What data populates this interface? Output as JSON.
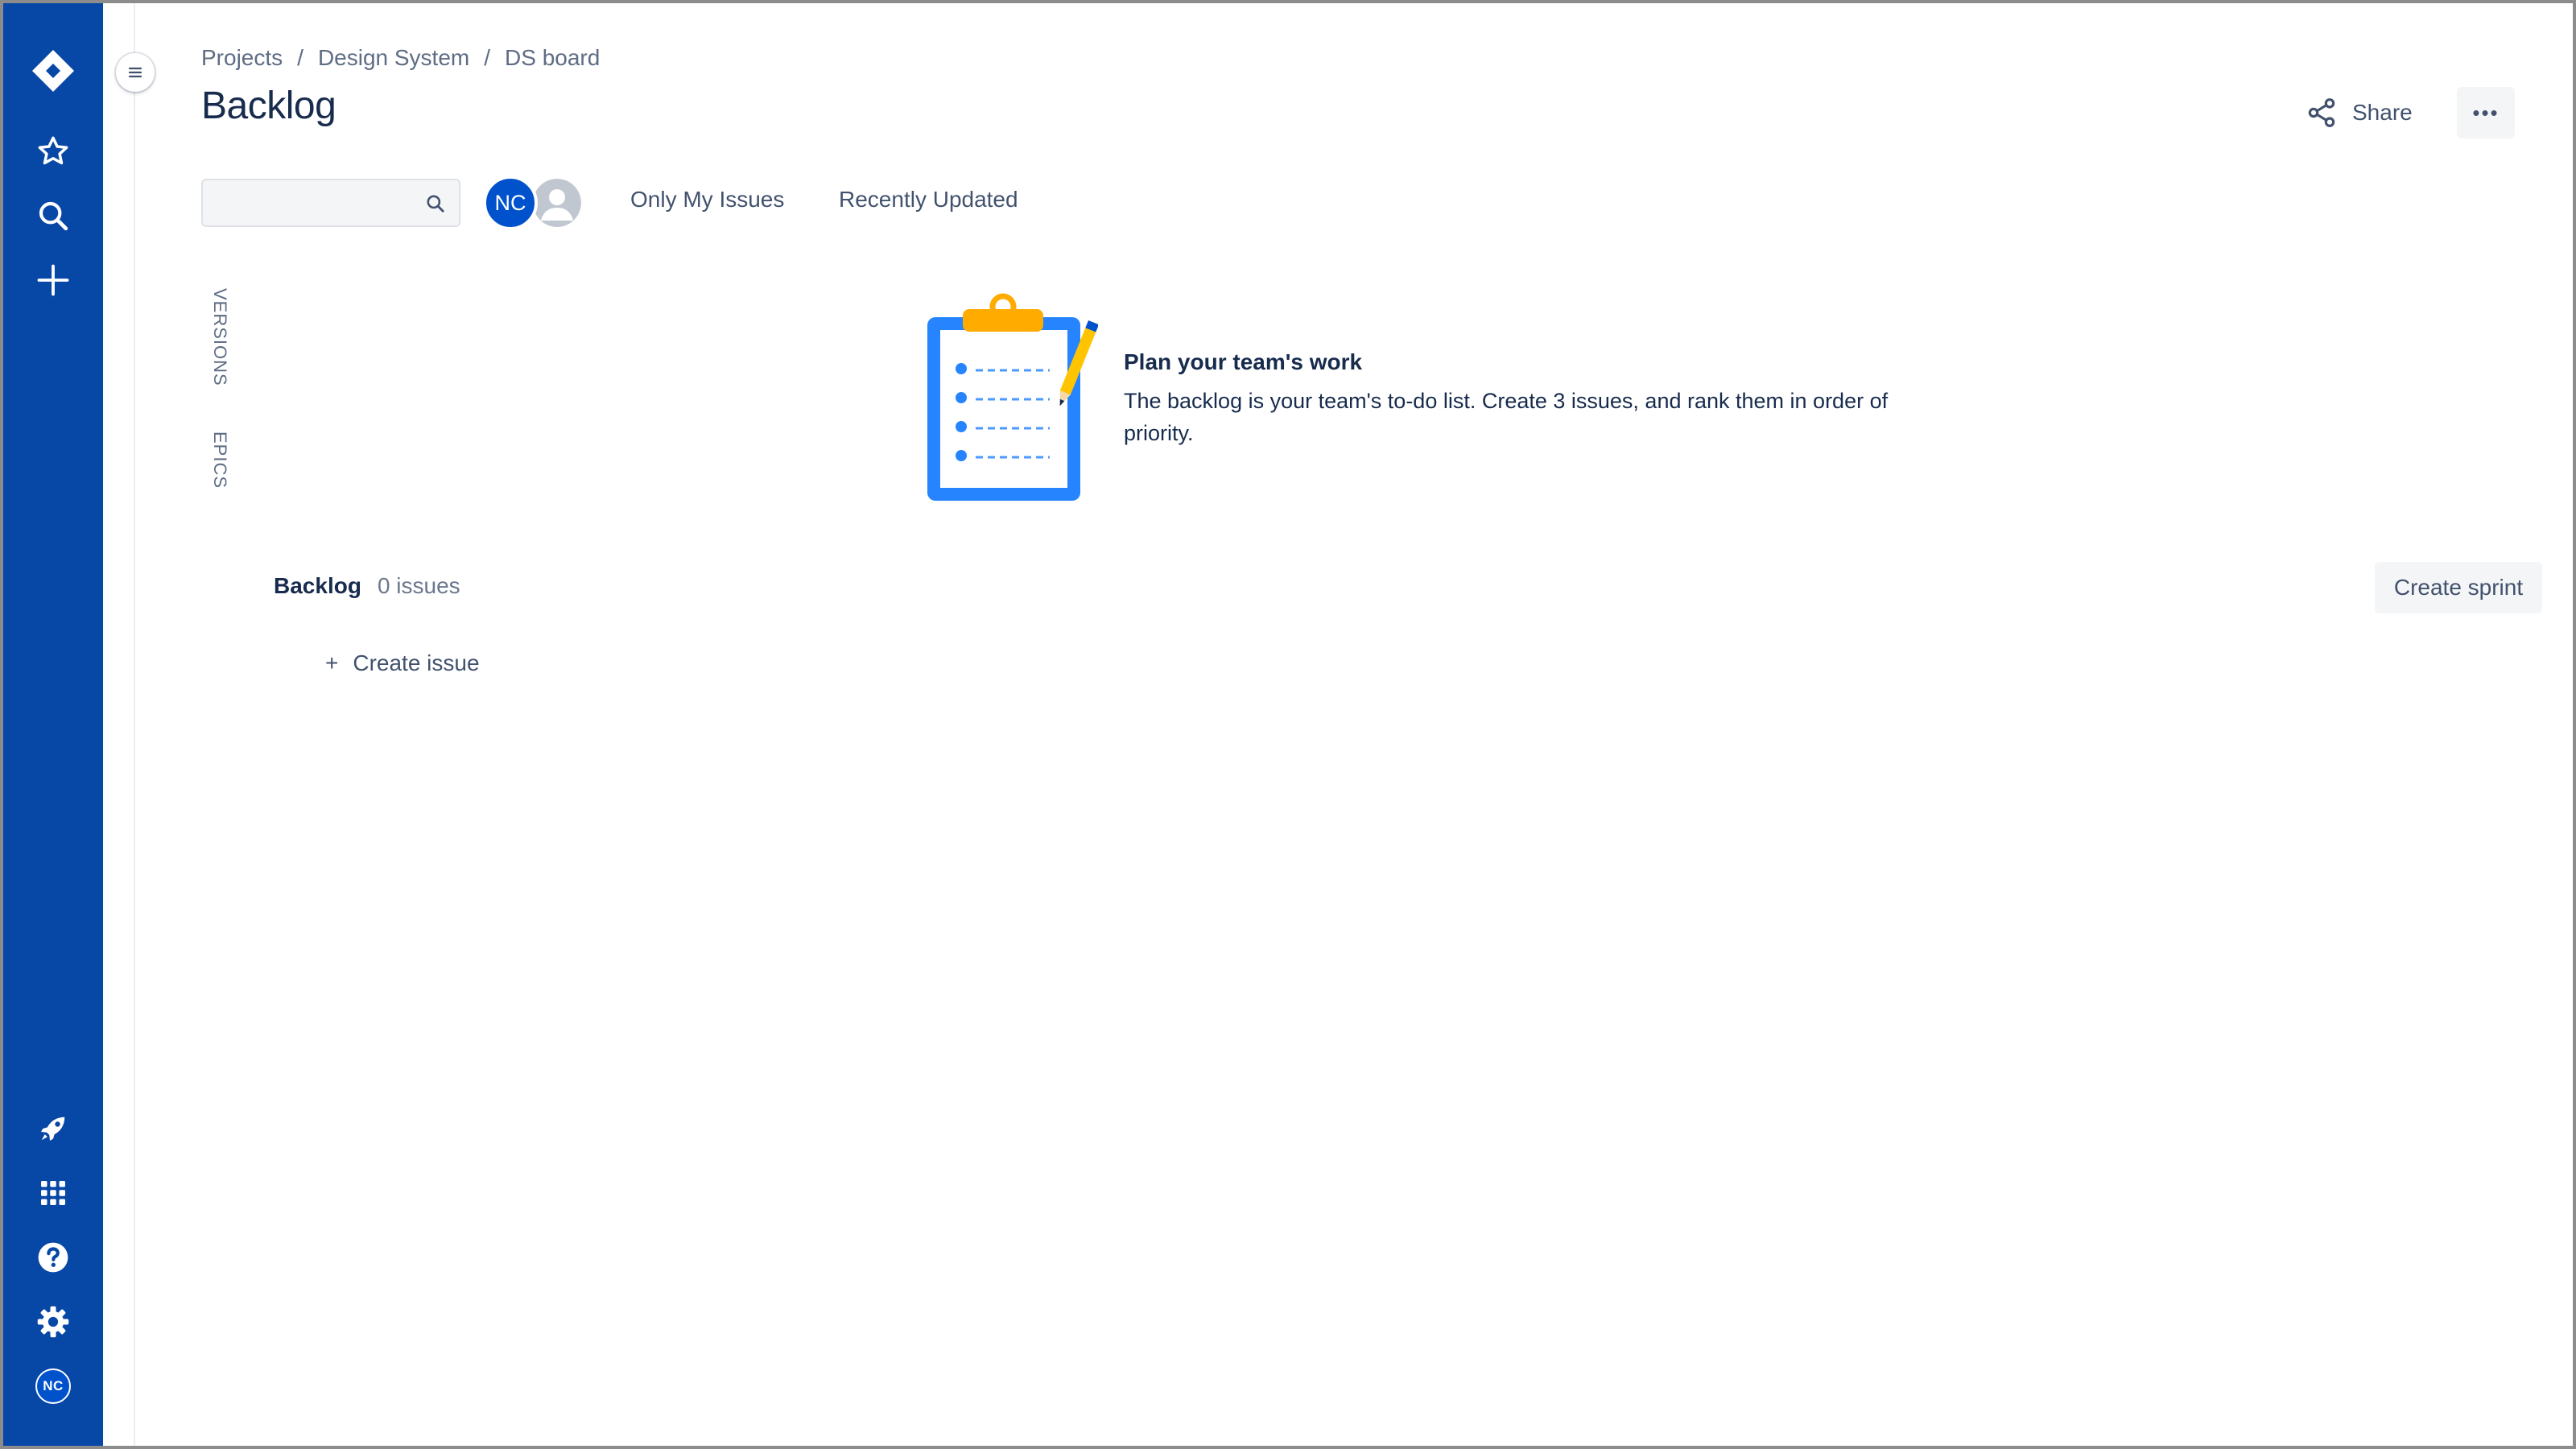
{
  "global_nav": {
    "items": [
      {
        "name": "jira-logo-icon"
      },
      {
        "name": "starred-icon"
      },
      {
        "name": "search-icon"
      },
      {
        "name": "create-icon"
      },
      {
        "name": "rocket-icon"
      },
      {
        "name": "app-switcher-icon"
      },
      {
        "name": "help-icon"
      },
      {
        "name": "settings-icon"
      }
    ],
    "avatar_initials": "NC",
    "color": "#0747a6"
  },
  "breadcrumb": {
    "items": [
      "Projects",
      "Design System",
      "DS board"
    ],
    "separator": "/"
  },
  "page": {
    "title": "Backlog"
  },
  "header_actions": {
    "share_label": "Share",
    "more_label": "•••"
  },
  "filters": {
    "search_placeholder": "",
    "search_value": "",
    "avatar_initials": "NC",
    "quick_filters": [
      "Only My Issues",
      "Recently Updated"
    ]
  },
  "side_panels": {
    "versions": "VERSIONS",
    "epics": "EPICS"
  },
  "empty_state": {
    "heading": "Plan your team's work",
    "body": "The backlog is your team's to-do list. Create 3 issues, and rank them in order of priority."
  },
  "backlog": {
    "name": "Backlog",
    "issue_count": "0 issues",
    "create_sprint_label": "Create sprint",
    "create_issue_plus": "+",
    "create_issue_label": "Create issue"
  },
  "colors": {
    "nav_blue": "#0747a6",
    "brand_blue": "#0052cc",
    "text_primary": "#172b4d",
    "text_secondary": "#42526e",
    "button_bg": "#f4f5f7",
    "clipboard_yellow": "#ffab00"
  }
}
